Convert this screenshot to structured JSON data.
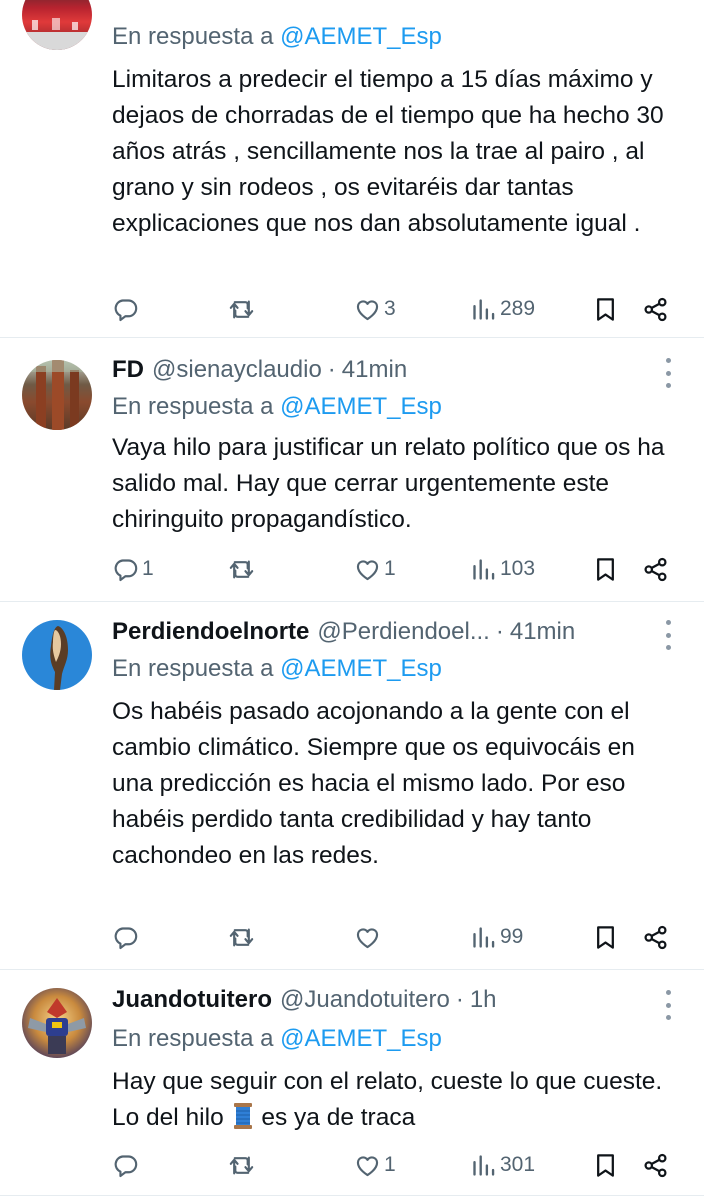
{
  "tweets": [
    {
      "name": "",
      "handle": "",
      "time": "",
      "reply_prefix": "En respuesta a",
      "reply_to": "@AEMET_Esp",
      "text": "Limitaros a predecir el tiempo a 15 días máximo y dejaos de chorradas de el tiempo que ha hecho 30 años atrás , sencillamente nos la trae al pairo , al grano y sin rodeos , os evitaréis dar tantas explicaciones que nos dan absolutamente igual .",
      "replies": "",
      "retweets": "",
      "likes": "3",
      "views": "289"
    },
    {
      "name": "FD",
      "handle": "@sienayclaudio",
      "time": "41min",
      "reply_prefix": "En respuesta a",
      "reply_to": "@AEMET_Esp",
      "text": "Vaya hilo para justificar un relato político que os ha salido mal. Hay que cerrar urgentemente este chiringuito propagandístico.",
      "replies": "1",
      "retweets": "",
      "likes": "1",
      "views": "103"
    },
    {
      "name": "Perdiendoelnorte",
      "handle": "@Perdiendoel...",
      "time": "41min",
      "reply_prefix": "En respuesta a",
      "reply_to": "@AEMET_Esp",
      "text": "Os habéis pasado acojonando a la gente con el cambio climático. Siempre que os equivocáis en una predicción es hacia el mismo lado. Por eso habéis perdido tanta credibilidad y hay tanto cachondeo en las redes.",
      "replies": "",
      "retweets": "",
      "likes": "",
      "views": "99"
    },
    {
      "name": "Juandotuitero",
      "handle": "@Juandotuitero",
      "time": "1h",
      "reply_prefix": "En respuesta a",
      "reply_to": "@AEMET_Esp",
      "text_before": "Hay que seguir con el relato, cueste lo que cueste. Lo del hilo",
      "text_after": "es ya de traca",
      "replies": "",
      "retweets": "",
      "likes": "1",
      "views": "301"
    }
  ],
  "separator": "·",
  "colors": {
    "secondary_text": "#536471",
    "mention": "#1d9bf0",
    "divider": "#e6ecf0",
    "text": "#0f1419"
  },
  "icons": [
    "reply-icon",
    "retweet-icon",
    "like-icon",
    "views-icon",
    "bookmark-icon",
    "share-icon",
    "thread-spool-emoji",
    "more-options-icon"
  ]
}
